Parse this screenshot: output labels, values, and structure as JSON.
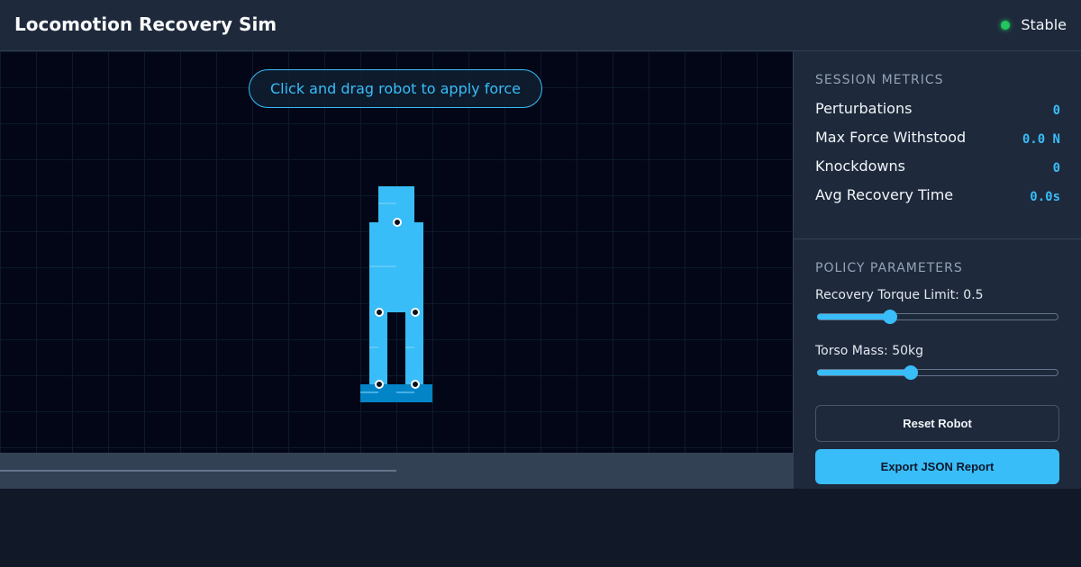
{
  "header": {
    "title": "Locomotion Recovery Sim",
    "status_label": "Stable",
    "status_color": "#22c55e"
  },
  "simulation": {
    "hint": "Click and drag robot to apply force"
  },
  "metrics": {
    "title": "SESSION METRICS",
    "items": [
      {
        "label": "Perturbations",
        "value": "0"
      },
      {
        "label": "Max Force Withstood",
        "value": "0.0 N"
      },
      {
        "label": "Knockdowns",
        "value": "0"
      },
      {
        "label": "Avg Recovery Time",
        "value": "0.0s"
      }
    ]
  },
  "params": {
    "title": "POLICY PARAMETERS",
    "torque": {
      "label": "Recovery Torque Limit: 0.5",
      "fraction": 0.3
    },
    "mass": {
      "label": "Torso Mass: 50kg",
      "fraction": 0.385
    }
  },
  "buttons": {
    "reset": "Reset Robot",
    "export": "Export JSON Report"
  },
  "colors": {
    "accent": "#38bdf8",
    "background": "#111827",
    "panel": "#1e293b"
  }
}
